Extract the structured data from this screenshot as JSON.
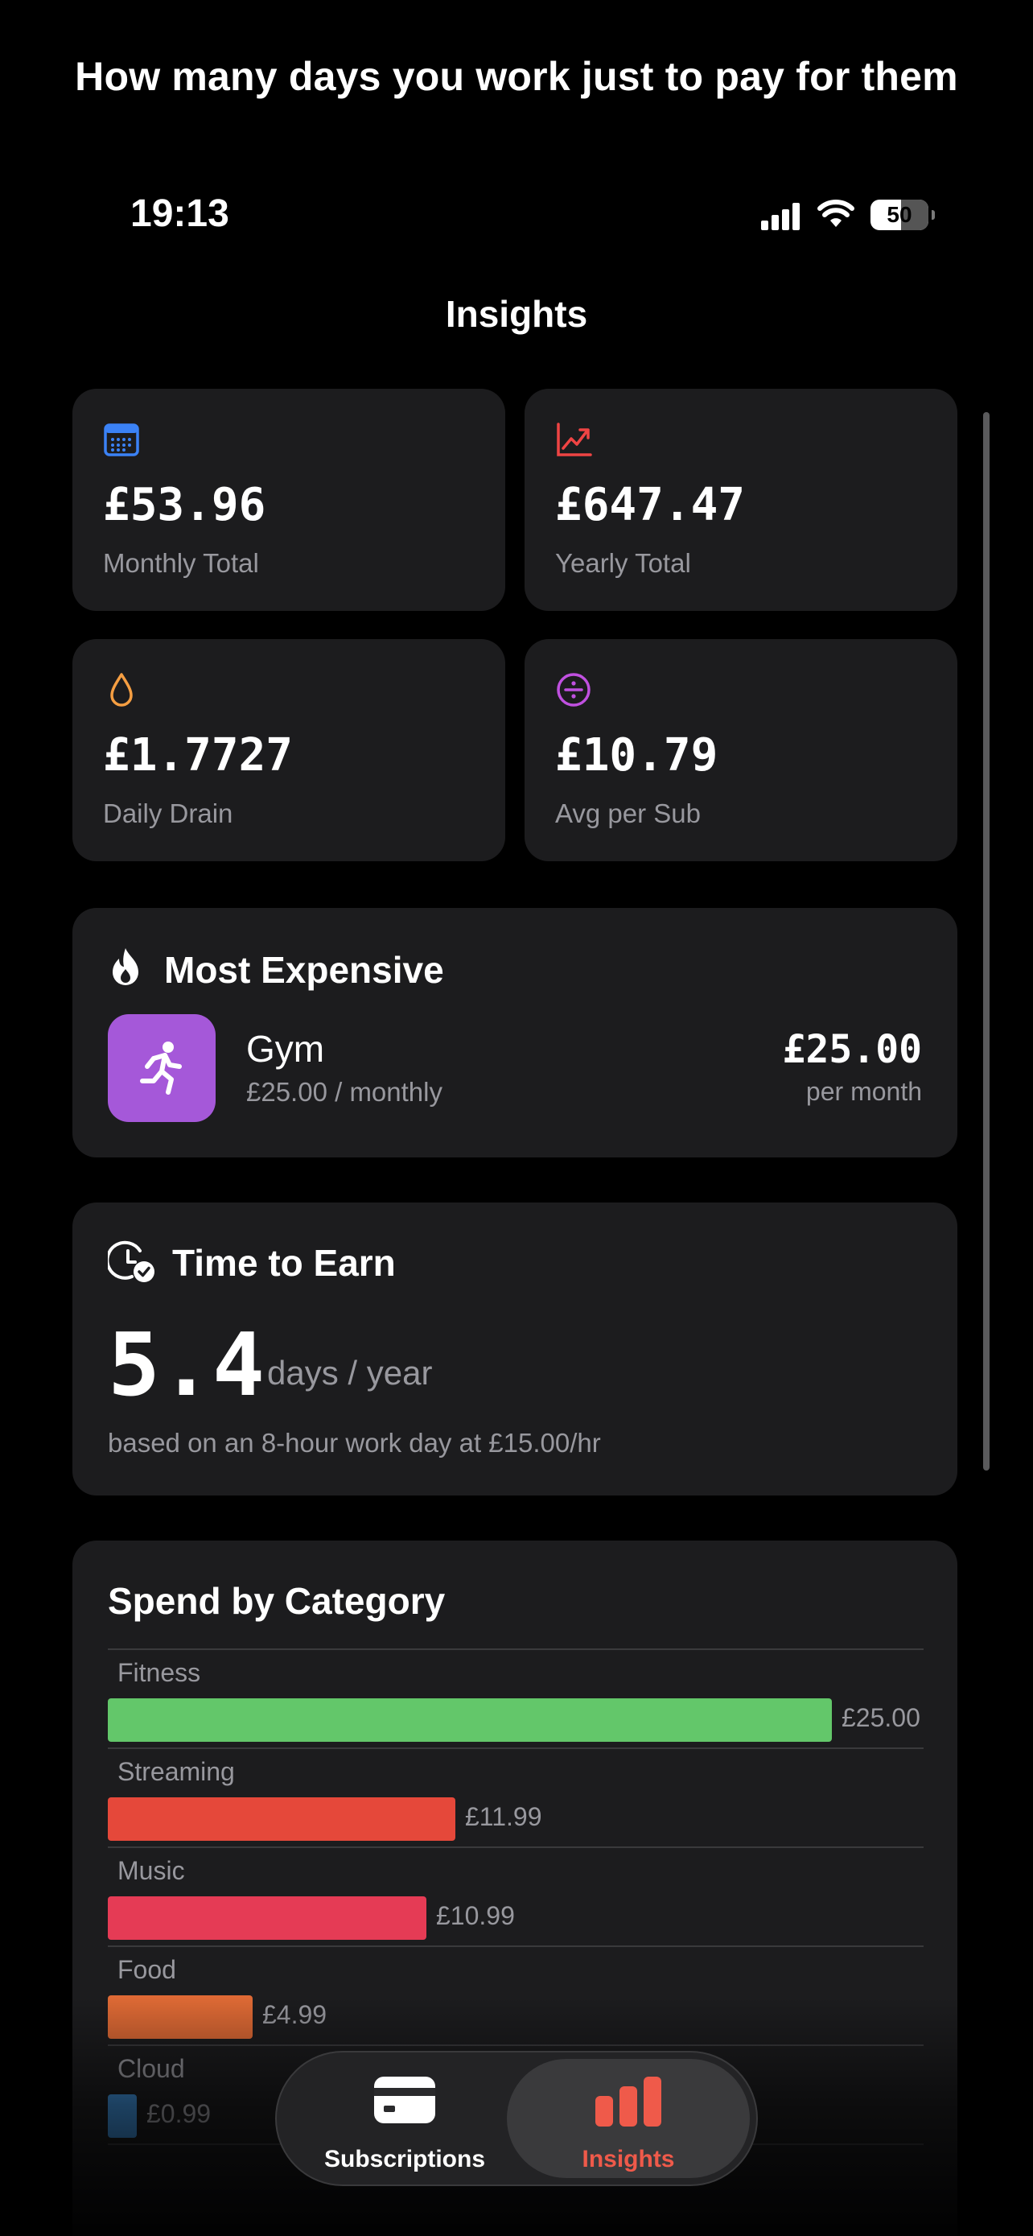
{
  "headline": "How many days you work just to pay for them",
  "status_bar": {
    "time": "19:13",
    "battery": "50"
  },
  "page_title": "Insights",
  "stats": [
    {
      "value": "£53.96",
      "label": "Monthly Total",
      "icon": "calendar-icon",
      "color": "#3b82f6"
    },
    {
      "value": "£647.47",
      "label": "Yearly Total",
      "icon": "chart-line-icon",
      "color": "#ef4444"
    },
    {
      "value": "£1.7727",
      "label": "Daily Drain",
      "icon": "drop-icon",
      "color": "#f59e42"
    },
    {
      "value": "£10.79",
      "label": "Avg per Sub",
      "icon": "divide-icon",
      "color": "#c050e0"
    }
  ],
  "most_expensive": {
    "title": "Most Expensive",
    "name": "Gym",
    "subtitle": "£25.00 / monthly",
    "price": "£25.00",
    "per": "per month",
    "tile_color": "#a558d9"
  },
  "time_to_earn": {
    "title": "Time to Earn",
    "value": "5.4",
    "unit": "days / year",
    "note": "based on an 8-hour work day at £15.00/hr"
  },
  "spend_by_category": {
    "title": "Spend by Category",
    "max_value": 25.0,
    "categories": [
      {
        "name": "Fitness",
        "value": 25.0,
        "amount": "£25.00",
        "color": "#63c76a"
      },
      {
        "name": "Streaming",
        "value": 11.99,
        "amount": "£11.99",
        "color": "#e5483a"
      },
      {
        "name": "Music",
        "value": 10.99,
        "amount": "£10.99",
        "color": "#e53b55"
      },
      {
        "name": "Food",
        "value": 4.99,
        "amount": "£4.99",
        "color": "#df6a35"
      },
      {
        "name": "Cloud",
        "value": 0.99,
        "amount": "£0.99",
        "color": "#3f8fd6"
      }
    ]
  },
  "tabs": [
    {
      "label": "Subscriptions",
      "icon": "credit-card-icon",
      "active": false
    },
    {
      "label": "Insights",
      "icon": "bar-chart-icon",
      "active": true
    }
  ]
}
